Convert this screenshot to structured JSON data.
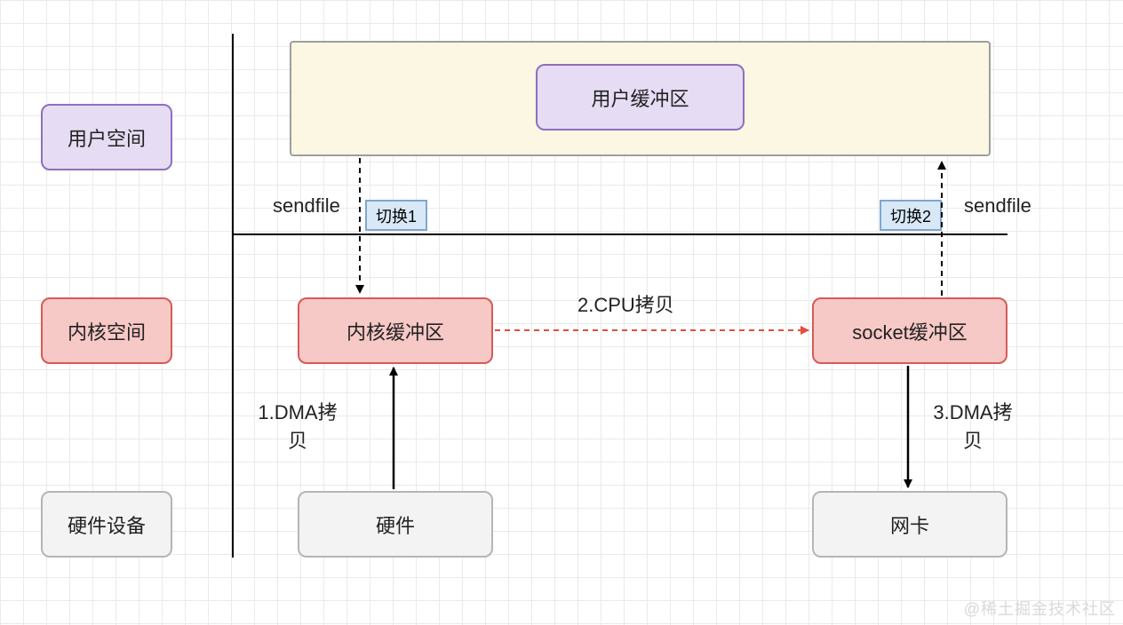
{
  "diagram": {
    "rowLabels": {
      "userSpace": "用户空间",
      "kernelSpace": "内核空间",
      "hardware": "硬件设备"
    },
    "userArea": {
      "userBuffer": "用户缓冲区"
    },
    "kernel": {
      "kernelBuffer": "内核缓冲区",
      "socketBuffer": "socket缓冲区"
    },
    "hardwareBoxes": {
      "disk": "硬件",
      "nic": "网卡"
    },
    "switches": {
      "switch1": "切换1",
      "switch2": "切换2"
    },
    "annotations": {
      "sendfileLeft": "sendfile",
      "sendfileRight": "sendfile",
      "dmaCopy1": "1.DMA拷贝",
      "cpuCopy": "2.CPU拷贝",
      "dmaCopy2": "3.DMA拷贝"
    },
    "colors": {
      "purpleFill": "#e6dcf3",
      "purpleBorder": "#8e6fbf",
      "redFill": "#f6c8c6",
      "redBorder": "#d65b56",
      "grayFill": "#f3f3f3",
      "grayBorder": "#b5b5b5",
      "creamFill": "#fbf7e2",
      "blueFill": "#d8e8f7",
      "blueBorder": "#7fa7cf",
      "arrowRed": "#e74c3c"
    },
    "watermark": "@稀土掘金技术社区"
  }
}
